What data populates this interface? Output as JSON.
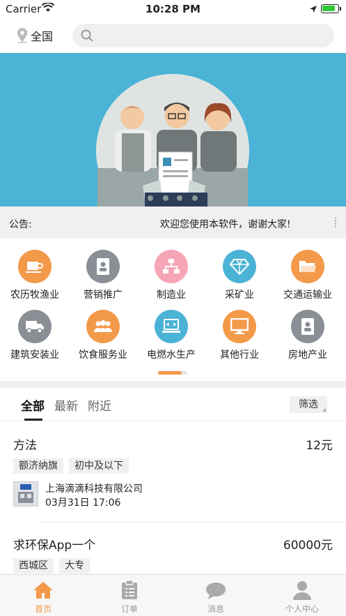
{
  "status_bar": {
    "carrier": "Carrier",
    "time": "10:28 PM",
    "battery_level": 0.9
  },
  "header": {
    "city": "全国",
    "search_placeholder": ""
  },
  "notice": {
    "label": "公告:",
    "message": "欢迎您使用本软件，谢谢大家!"
  },
  "categories": [
    {
      "label": "农历牧渔业",
      "icon": "cup-icon",
      "color": "#f39a4a"
    },
    {
      "label": "营销推广",
      "icon": "id-card-icon",
      "color": "#8a8f96"
    },
    {
      "label": "制造业",
      "icon": "network-icon",
      "color": "#f6a5b6"
    },
    {
      "label": "采矿业",
      "icon": "diamond-icon",
      "color": "#4bb3d6"
    },
    {
      "label": "交通运输业",
      "icon": "folder-icon",
      "color": "#f39a4a"
    },
    {
      "label": "建筑安装业",
      "icon": "truck-icon",
      "color": "#8a8f96"
    },
    {
      "label": "饮食服务业",
      "icon": "group-icon",
      "color": "#f39a4a"
    },
    {
      "label": "电燃水生产",
      "icon": "laptop-icon",
      "color": "#4bb3d6"
    },
    {
      "label": "其他行业",
      "icon": "monitor-icon",
      "color": "#f39a4a"
    },
    {
      "label": "房地产业",
      "icon": "id-card-icon",
      "color": "#8a8f96"
    }
  ],
  "tabs": {
    "all": "全部",
    "latest": "最新",
    "nearby": "附近",
    "filter": "筛选"
  },
  "listings": [
    {
      "title": "方法",
      "price": "12元",
      "tags": [
        "额济纳旗",
        "初中及以下"
      ],
      "company": "上海滴滴科技有限公司",
      "date": "03月31日 17:06"
    },
    {
      "title": "求环保App一个",
      "price": "60000元",
      "tags": [
        "西城区",
        "大专"
      ]
    }
  ],
  "nav": {
    "home": "首页",
    "orders": "订单",
    "messages": "消息",
    "profile": "个人中心"
  },
  "colors": {
    "accent": "#f39a4a",
    "banner": "#4bb3d6"
  }
}
